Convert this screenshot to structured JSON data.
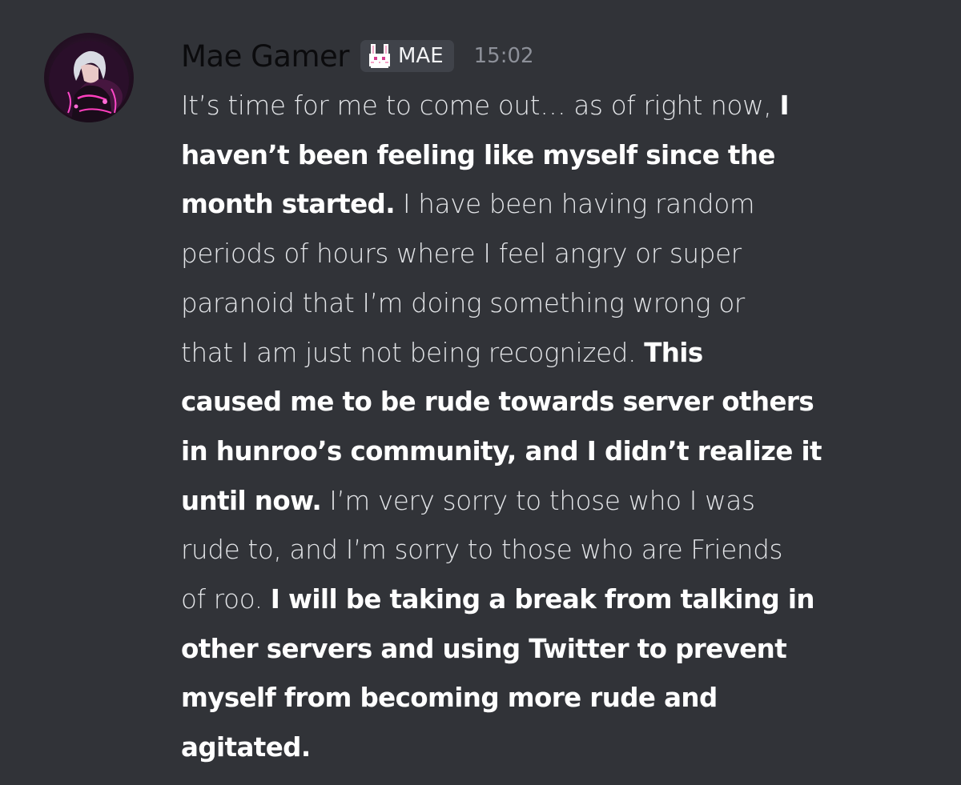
{
  "message": {
    "author": "Mae Gamer",
    "role_tag": {
      "label": "MAE",
      "icon": "bunny-icon"
    },
    "timestamp": "15:02",
    "text": {
      "l1a": "It’s time for me to come out… as of right now, ",
      "l1b": "I",
      "l2": "haven’t been feeling like myself since the",
      "l3a": "month started.",
      "l3b": " I have been having random",
      "l4": "periods of hours where I feel angry or super",
      "l5": "paranoid that I’m doing something wrong or",
      "l6a": "that I am just not being recognized. ",
      "l6b": "This",
      "l7": "caused me to be rude towards server others",
      "l8": "in hunroo’s community, and I didn’t realize it",
      "l9a": "until now.",
      "l9b": " I’m very sorry to those who I was",
      "l10": "rude to, and I’m sorry to those who are Friends",
      "l11a": "of roo. ",
      "l11b": "I will be taking a break from talking in",
      "l12": "other servers and using Twitter to prevent",
      "l13": "myself from becoming more rude and",
      "l14": "agitated."
    }
  },
  "colors": {
    "background": "#313338",
    "author_name": "#0b0b0d",
    "role_tag_bg": "#40434a",
    "timestamp": "#8d9099",
    "message_text": "#eef0f3"
  }
}
